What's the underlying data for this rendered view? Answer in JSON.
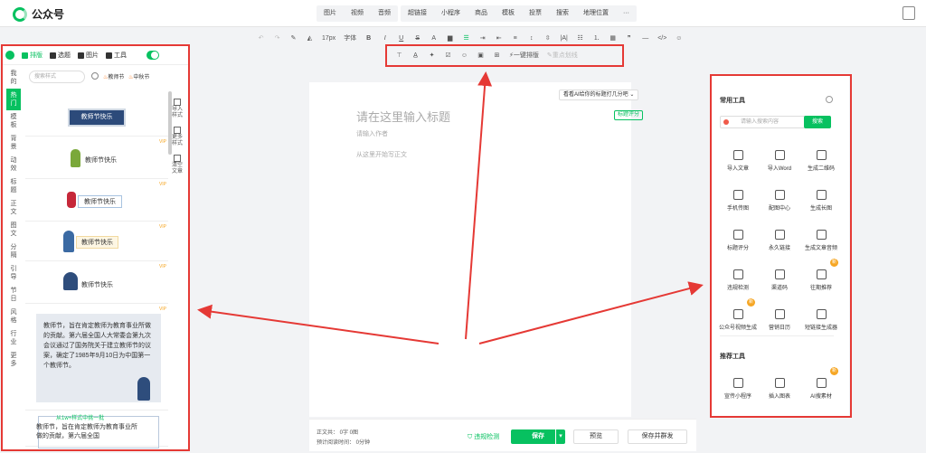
{
  "app": {
    "name": "公众号"
  },
  "top_nav": {
    "group1": [
      "图片",
      "视频",
      "音频"
    ],
    "group2": [
      "超链接",
      "小程序",
      "商品",
      "模板",
      "投票",
      "搜索",
      "地理位置",
      "···"
    ]
  },
  "toolbar": {
    "font_size": "17px",
    "font_label": "字体",
    "items": [
      "B",
      "I",
      "U",
      "S",
      "A"
    ]
  },
  "toolbar2": {
    "one_click_layout": "一键排版",
    "focus_mark": "重点划线"
  },
  "left_panel": {
    "tabs": [
      {
        "label": "排版",
        "active": true
      },
      {
        "label": "选题",
        "active": false
      },
      {
        "label": "图片",
        "active": false
      },
      {
        "label": "工具",
        "active": false
      }
    ],
    "vertical_nav": [
      "我的",
      "热门",
      "模板",
      "背景",
      "动效",
      "标题",
      "正文",
      "图文",
      "分隔",
      "引导",
      "节日",
      "风格",
      "行业",
      "更多"
    ],
    "active_nav_index": 1,
    "search_placeholder": "搜索样式",
    "chips": [
      "教师节",
      "中秋节"
    ],
    "templates": [
      {
        "title": "教师节快乐"
      },
      {
        "title": "教师节快乐"
      },
      {
        "title": "教师节快乐"
      },
      {
        "title": "教师节快乐"
      },
      {
        "title": "教师节快乐"
      }
    ],
    "note_text": "教师节，旨在肯定教师为教育事业所做的贡献。第六届全国人大常委会第九次会议通过了国务院关于建立教师节的议案，确定了1985年9月10日为中国第一个教师节。",
    "bottom_card_header": "从1w+样式中挑一批",
    "bottom_card_text": "教师节，旨在肯定教师为教育事业所做的贡献，第六届全国",
    "vip_label": "VIP",
    "side_tools": [
      "导入样式",
      "更多样式",
      "清空文章"
    ]
  },
  "editor": {
    "ai_tag": "看看AI给你的标题打几分吧 ⌄",
    "score_tag": "标题评分",
    "title_placeholder": "请在这里输入标题",
    "author_placeholder": "请输入作者",
    "body_placeholder": "从这里开始写正文"
  },
  "footer": {
    "count_line1": "正文共： 0字 0图",
    "count_line2": "预计阅读时间： 0分钟",
    "check_label": "违规检测",
    "save_label": "保存",
    "preview_label": "预览",
    "save_publish_label": "保存并群发"
  },
  "right_panel": {
    "common_title": "常用工具",
    "search_placeholder": "请输入搜索内容",
    "search_button": "搜索",
    "tools": [
      {
        "label": "导入文章",
        "new": false
      },
      {
        "label": "导入Word",
        "new": false
      },
      {
        "label": "生成二维码",
        "new": false
      },
      {
        "label": "手机传图",
        "new": false
      },
      {
        "label": "配图中心",
        "new": false
      },
      {
        "label": "生成长图",
        "new": false
      },
      {
        "label": "标题评分",
        "new": false
      },
      {
        "label": "永久链接",
        "new": false
      },
      {
        "label": "生成文章音频",
        "new": false
      },
      {
        "label": "违规检测",
        "new": false
      },
      {
        "label": "渠道码",
        "new": false
      },
      {
        "label": "往期推荐",
        "new": true
      },
      {
        "label": "公众号视频生成",
        "new": true
      },
      {
        "label": "营销日历",
        "new": false
      },
      {
        "label": "短链接生成器",
        "new": false
      }
    ],
    "recommended_title": "推荐工具",
    "recommended": [
      {
        "label": "宣传小程序",
        "new": false
      },
      {
        "label": "插入图表",
        "new": false
      },
      {
        "label": "AI搜素材",
        "new": true
      }
    ],
    "new_badge": "新"
  },
  "colors": {
    "brand_green": "#07c160",
    "annotation_red": "#e53935"
  }
}
